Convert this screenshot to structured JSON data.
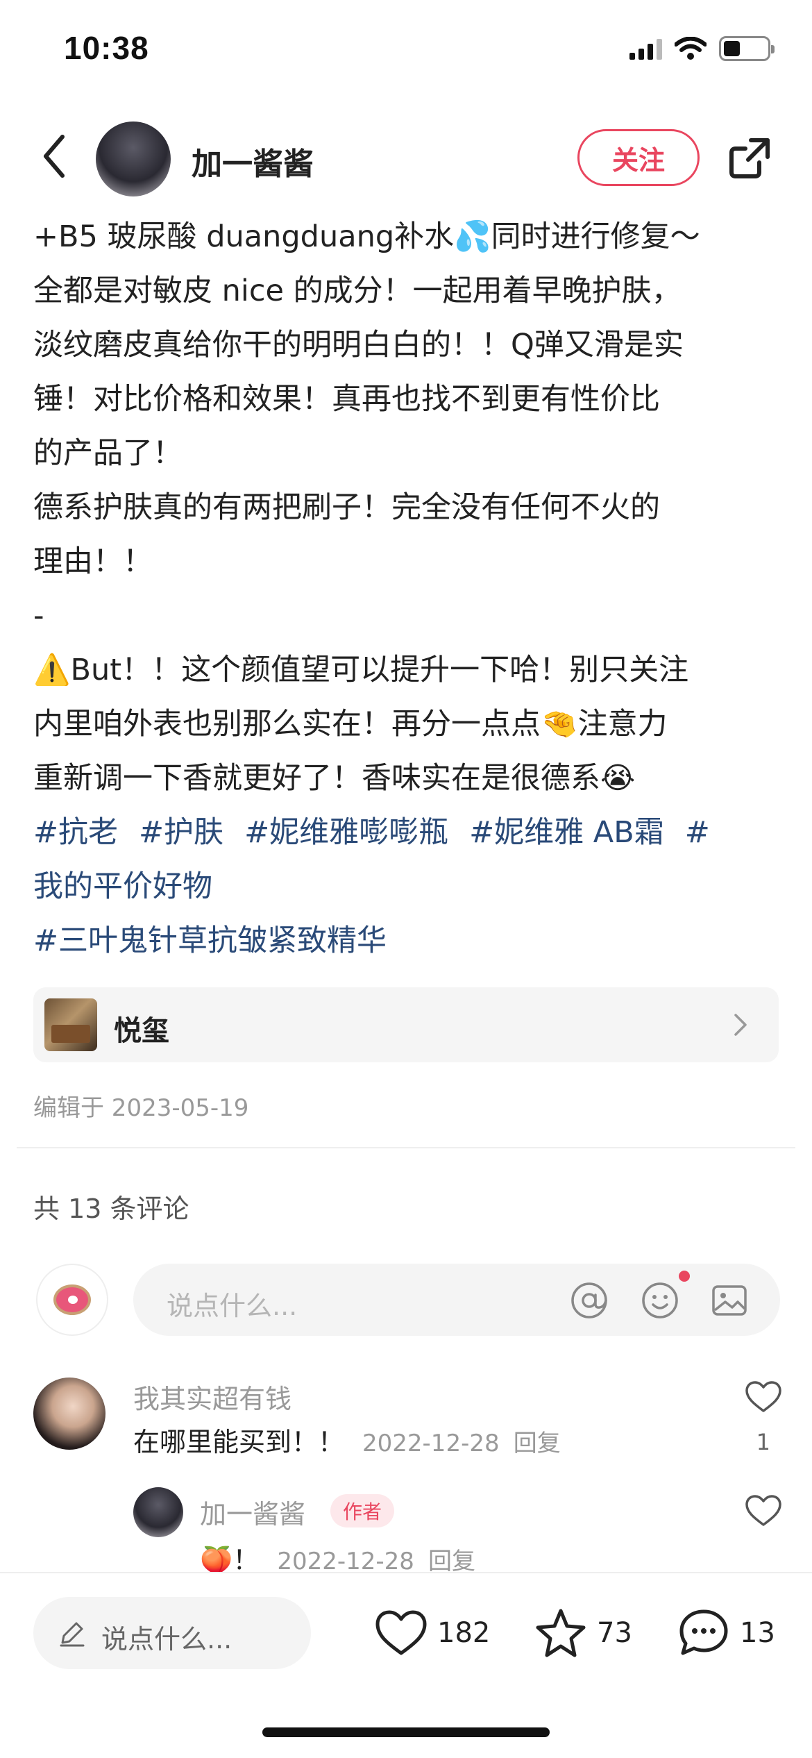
{
  "status_bar": {
    "time": "10:38"
  },
  "header": {
    "author_name": "加一酱酱",
    "follow_label": "关注"
  },
  "post": {
    "lines": [
      "+B5 玻尿酸 duangduang补水💦同时进行修复～",
      "全都是对敏皮 nice 的成分！一起用着早晚护肤，",
      "淡纹磨皮真给你干的明明白白的！！Q弹又滑是实",
      "锤！对比价格和效果！真再也找不到更有性价比",
      "的产品了！",
      "德系护肤真的有两把刷子！完全没有任何不火的",
      "理由！！",
      "-",
      "⚠️But！！这个颜值望可以提升一下哈！别只关注",
      "内里咱外表也别那么实在！再分一点点🤏注意力",
      "重新调一下香就更好了！香味实在是很德系😭"
    ],
    "tags_row1": [
      "#抗老",
      "#护肤",
      "#妮维雅嘭嘭瓶",
      "#妮维雅 AB霜",
      "#"
    ],
    "tags_row2": [
      "我的平价好物"
    ],
    "tags_row3": [
      "#三叶鬼针草抗皱紧致精华"
    ]
  },
  "location": {
    "name": "悦玺"
  },
  "edit_date": "编辑于 2023-05-19",
  "comments_header": {
    "count_text": "共 13 条评论"
  },
  "comment_box": {
    "placeholder": "说点什么..."
  },
  "comments": [
    {
      "user": "我其实超有钱",
      "text": "在哪里能买到！！",
      "date": "2022-12-28",
      "reply_label": "回复",
      "likes": "1"
    }
  ],
  "reply": {
    "user": "加一酱酱",
    "badge": "作者",
    "text": "🍑！",
    "date": "2022-12-28",
    "reply_label": "回复"
  },
  "bottom_bar": {
    "placeholder": "说点什么...",
    "likes": "182",
    "favorites": "73",
    "comments": "13"
  },
  "colors": {
    "accent": "#e9465f",
    "tag": "#2a4a78",
    "muted": "#999999"
  },
  "icons": [
    "back-icon",
    "share-icon",
    "chevron-right-icon",
    "at-icon",
    "emoji-icon",
    "image-icon",
    "heart-icon",
    "star-icon",
    "chat-icon",
    "pencil-icon"
  ]
}
